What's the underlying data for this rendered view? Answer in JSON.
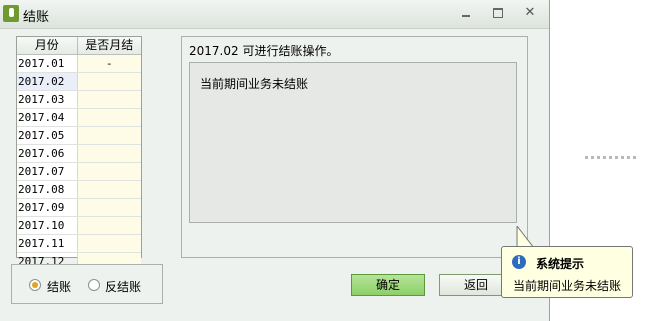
{
  "window": {
    "title": "结账"
  },
  "table": {
    "headers": [
      "月份",
      "是否月结"
    ],
    "rows": [
      {
        "month": "2017.01",
        "closed": "-"
      },
      {
        "month": "2017.02",
        "closed": ""
      },
      {
        "month": "2017.03",
        "closed": ""
      },
      {
        "month": "2017.04",
        "closed": ""
      },
      {
        "month": "2017.05",
        "closed": ""
      },
      {
        "month": "2017.06",
        "closed": ""
      },
      {
        "month": "2017.07",
        "closed": ""
      },
      {
        "month": "2017.08",
        "closed": ""
      },
      {
        "month": "2017.09",
        "closed": ""
      },
      {
        "month": "2017.10",
        "closed": ""
      },
      {
        "month": "2017.11",
        "closed": ""
      },
      {
        "month": "2017.12",
        "closed": ""
      }
    ]
  },
  "message": {
    "status": "2017.02 可进行结账操作。",
    "detail": "当前期间业务未结账"
  },
  "options": {
    "close_label": "结账",
    "reverse_label": "反结账",
    "selected": "结账"
  },
  "buttons": {
    "confirm": "确定",
    "back": "返回"
  },
  "tooltip": {
    "title": "系统提示",
    "body": "当前期间业务未结账"
  },
  "colors": {
    "accent_green": "#8ccf67",
    "radio_selected": "#e2a225",
    "tooltip_bg": "#ffffe1"
  }
}
